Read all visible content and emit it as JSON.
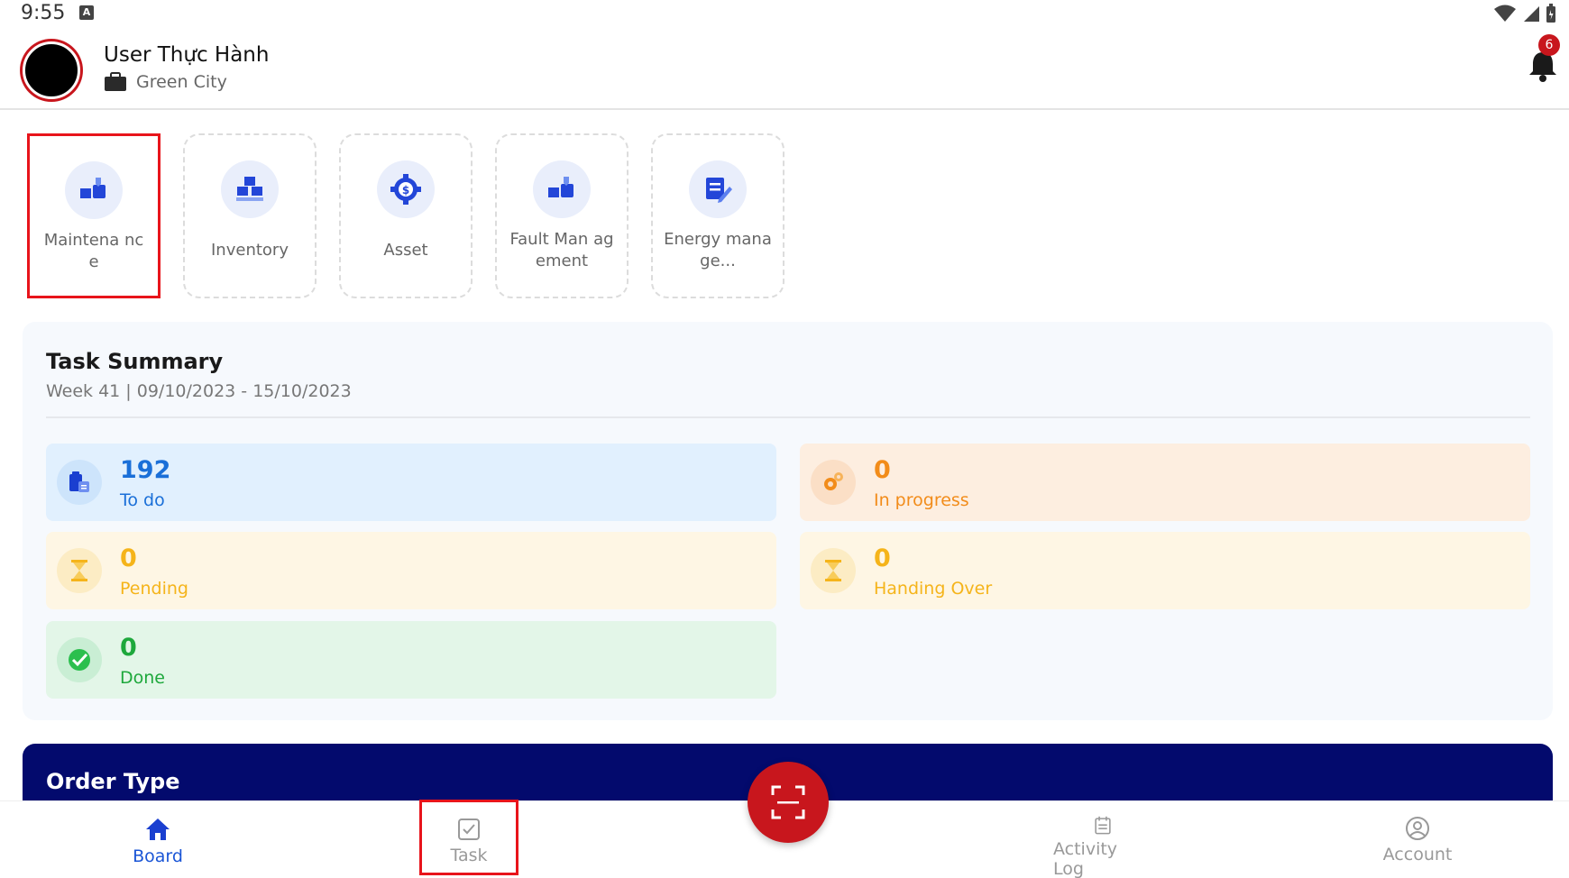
{
  "status_bar": {
    "time": "9:55",
    "keyboard_indicator": "A"
  },
  "header": {
    "user_name": "User Thực Hành",
    "org_name": "Green City",
    "notification_count": "6"
  },
  "modules": [
    {
      "label": "Maintena nce",
      "icon": "maintenance-icon",
      "selected": true
    },
    {
      "label": "Inventory",
      "icon": "inventory-icon"
    },
    {
      "label": "Asset",
      "icon": "asset-gear-dollar-icon"
    },
    {
      "label": "Fault Man agement",
      "icon": "fault-management-icon"
    },
    {
      "label": "Energy manage...",
      "icon": "energy-management-icon"
    }
  ],
  "task_summary": {
    "title": "Task Summary",
    "week": "Week 41 | 09/10/2023 - 15/10/2023",
    "stats": [
      {
        "count": "192",
        "label": "To do",
        "icon": "clipboard-icon",
        "color": "#1a6fd8",
        "bg": "#e1f0fe"
      },
      {
        "count": "0",
        "label": "In progress",
        "icon": "gears-icon",
        "color": "#f28c1a",
        "bg": "#fdeee0"
      },
      {
        "count": "0",
        "label": "Pending",
        "icon": "hourglass-icon",
        "color": "#f5b41a",
        "bg": "#fef6e4"
      },
      {
        "count": "0",
        "label": "Handing Over",
        "icon": "hourglass-icon",
        "color": "#f5b41a",
        "bg": "#fef6e4"
      },
      {
        "count": "0",
        "label": "Done",
        "icon": "check-circle-icon",
        "color": "#1ea83c",
        "bg": "#e3f6e8"
      }
    ]
  },
  "order_type": {
    "title": "Order Type"
  },
  "bottom_nav": {
    "items": [
      {
        "label": "Board",
        "icon": "home-icon",
        "active": true
      },
      {
        "label": "Task",
        "icon": "task-check-icon"
      },
      {
        "label": "Activity Log",
        "icon": "activity-log-icon"
      },
      {
        "label": "Account",
        "icon": "account-icon"
      }
    ],
    "scan_icon": "scan-icon"
  },
  "colors": {
    "brand_red": "#c8161d",
    "primary_blue": "#1a55d6",
    "navy": "#030a6d"
  }
}
